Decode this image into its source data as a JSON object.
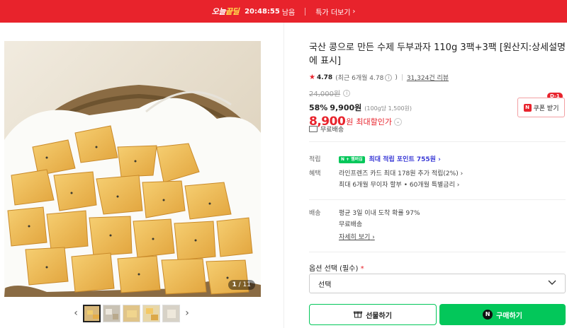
{
  "banner": {
    "badge_prefix": "오늘",
    "badge_suffix": "끝딜",
    "timer": "20:48:55",
    "remain": "남음",
    "more": "특가 더보기",
    "more_arrow": "›"
  },
  "gallery": {
    "page_current": "1",
    "page_total": "/ 11",
    "prev_icon": "‹",
    "next_icon": "›"
  },
  "product": {
    "title": "국산 콩으로 만든 수제 두부과자 110g 3팩+3팩 [원산지:상세설명에 표시]",
    "rating_score": "4.78",
    "rating_recent": "(최근 6개월 4.78",
    "rating_recent_close": ")",
    "review_count": "31,324건 리뷰",
    "original_price": "24,000원",
    "discount_pct": "58%",
    "sale_price": "9,900원",
    "unit_price": "(100g당 1,500원)",
    "final_price": "8,900",
    "final_won": "원",
    "final_label": "최대할인가",
    "coupon_button": "쿠폰 받기",
    "coupon_tag": "D-1",
    "shipping": "무료배송"
  },
  "rows": {
    "points_label": "적립",
    "points_value": "최대 적립 포인트 755원",
    "npay_text": "N",
    "npay_plus": "+",
    "npay_member": "멤버십",
    "benefit_label": "혜택",
    "benefit_1": "라인프렌즈 카드 최대 178원 추가 적립(2%)",
    "benefit_2": "최대 6개월 무이자 할부 • 60개월 특별금리",
    "delivery_label": "배송",
    "delivery_1": "평균 3일 이내 도착 확률 97%",
    "delivery_2": "무료배송",
    "delivery_more": "자세히 보기"
  },
  "option": {
    "label": "옵션 선택 (필수)",
    "required_mark": "*",
    "select_value": "선택"
  },
  "buttons": {
    "gift": "선물하기",
    "buy": "구매하기",
    "buy_icon": "N"
  },
  "colors": {
    "brand_red": "#e8232c",
    "naver_green": "#03c75a"
  }
}
